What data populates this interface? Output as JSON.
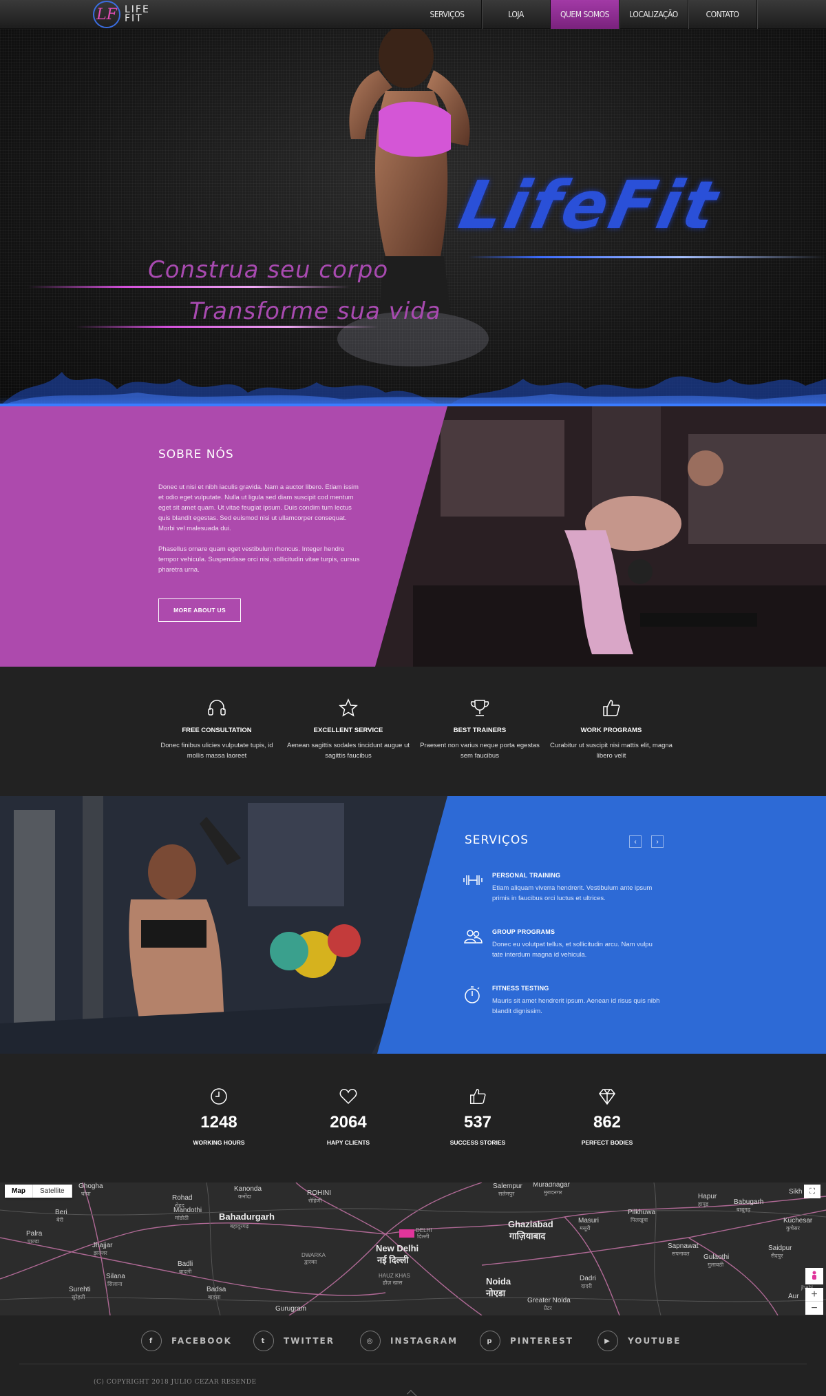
{
  "nav": {
    "logo_line1": "LIFE",
    "logo_line2": "FIT",
    "logo_mark": "LF",
    "items": [
      {
        "label": "SERVIÇOS",
        "active": false
      },
      {
        "label": "LOJA",
        "active": false
      },
      {
        "label": "QUEM SOMOS",
        "active": true
      },
      {
        "label": "LOCALIZAÇÃO",
        "active": false
      },
      {
        "label": "CONTATO",
        "active": false
      }
    ]
  },
  "hero": {
    "brand": "LifeFit",
    "slogan1": "Construa seu corpo",
    "slogan2": "Transforme sua vida"
  },
  "about": {
    "title": "SOBRE NÓS",
    "p1": "Donec ut nisi et nibh iaculis gravida. Nam a auctor libero. Etiam issim et odio eget vulputate. Nulla ut ligula sed diam suscipit cod mentum eget sit amet quam. Ut vitae feugiat ipsum. Duis condim tum lectus quis blandit egestas. Sed euismod nisi ut ullamcorper consequat. Morbi vel malesuada dui.",
    "p2": "Phasellus ornare quam eget vestibulum rhoncus. Integer hendre tempor vehicula. Suspendisse orci nisi, sollicitudin vitae turpis, cursus pharetra urna.",
    "button": "MORE ABOUT US"
  },
  "features": [
    {
      "icon": "headset-icon",
      "title": "FREE CONSULTATION",
      "desc": "Donec finibus ulicies vulputate tupis, id mollis massa laoreet"
    },
    {
      "icon": "star-icon",
      "title": "EXCELLENT SERVICE",
      "desc": "Aenean sagittis sodales tincidunt augue ut sagittis faucibus"
    },
    {
      "icon": "trophy-icon",
      "title": "BEST TRAINERS",
      "desc": "Praesent non varius neque porta egestas sem faucibus"
    },
    {
      "icon": "thumbs-up-icon",
      "title": "WORK PROGRAMS",
      "desc": "Curabitur ut suscipit nisi mattis elit, magna libero velit"
    }
  ],
  "services": {
    "title": "SERVIÇOS",
    "prev": "‹",
    "next": "›",
    "items": [
      {
        "icon": "dumbbell-icon",
        "title": "PERSONAL TRAINING",
        "desc": "Etiam aliquam viverra hendrerit. Vestibulum ante ipsum primis in faucibus orci luctus et ultrices."
      },
      {
        "icon": "group-icon",
        "title": "GROUP PROGRAMS",
        "desc": "Donec eu volutpat tellus, et sollicitudin arcu. Nam vulpu tate interdum magna id vehicula."
      },
      {
        "icon": "stopwatch-icon",
        "title": "FITNESS TESTING",
        "desc": "Mauris sit amet hendrerit ipsum. Aenean id risus quis nibh blandit dignissim."
      }
    ]
  },
  "stats": [
    {
      "icon": "clock-icon",
      "value": "1248",
      "label": "WORKING HOURS"
    },
    {
      "icon": "heart-icon",
      "value": "2064",
      "label": "HAPY CLIENTS"
    },
    {
      "icon": "thumbs-up-icon",
      "value": "537",
      "label": "SUCCESS STORIES"
    },
    {
      "icon": "diamond-icon",
      "value": "862",
      "label": "PERFECT BODIES"
    }
  ],
  "map": {
    "btn_map": "Map",
    "btn_satellite": "Satellite",
    "zoom_in": "+",
    "zoom_out": "−",
    "labels": {
      "ghogha": "Ghogha",
      "ghogha_hi": "घोघा",
      "kanonda": "Kanonda",
      "kanonda_hi": "कनोंदा",
      "rohini": "ROHINI",
      "rohini_hi": "रोहिणी",
      "salempur": "Salempur",
      "salempur_hi": "सलेमपुर",
      "muradnagar": "Muradnagar",
      "muradnagar_hi": "मुरादनगर",
      "hapur": "Hapur",
      "hapur_hi": "हापुड़",
      "babugarh": "Babugarh",
      "babugarh_hi": "बाबूगढ़",
      "sikh": "Sikh",
      "beri": "Beri",
      "beri_hi": "बेरी",
      "rohad": "Rohad",
      "rohad_hi": "रोहद",
      "mandothi": "Mandothi",
      "mandothi_hi": "मांडोठी",
      "bahadurgarh": "Bahadurgarh",
      "bahadurgarh_hi": "बहादुरगढ़",
      "ghaziabad": "Ghaziabad",
      "ghaziabad_hi": "गाज़ियाबाद",
      "masuri": "Masuri",
      "masuri_hi": "मसूरी",
      "pilkhuwa": "Pilkhuwa",
      "pilkhuwa_hi": "पिलखुवा",
      "kuchesar": "Kuchesar",
      "kuchesar_hi": "कुचेसर",
      "palra": "Palra",
      "palra_hi": "पाल्डा",
      "jhajjar": "Jhajjar",
      "jhajjar_hi": "झज्जर",
      "delhi": "DELHI",
      "delhi_hi": "दिल्ली",
      "new_delhi": "New Delhi",
      "new_delhi_hi": "नई दिल्ली",
      "dwarka": "DWARKA",
      "dwarka_hi": "द्वारका",
      "sapnawat": "Sapnawat",
      "sapnawat_hi": "सपनावत",
      "gulaothi": "Gulaothi",
      "gulaothi_hi": "गुलावठी",
      "saidpur": "Saidpur",
      "saidpur_hi": "सैदपुर",
      "badli": "Badli",
      "badli_hi": "बादली",
      "hauz_khas": "HAUZ KHAS",
      "hauz_khas_hi": "हौज़ खास",
      "silana": "Silana",
      "silana_hi": "सिलाना",
      "noida": "Noida",
      "noida_hi": "नोएडा",
      "dadri": "Dadri",
      "dadri_hi": "दादरी",
      "jhahi": "jhahi",
      "surehti": "Surehti",
      "surehti_hi": "सुरेहती",
      "badsa": "Badsa",
      "badsa_hi": "बादसा",
      "greater_noida": "Greater Noida",
      "greater_noida_hi": "ग्रेटर",
      "gurugram": "Gurugram",
      "aur": "Aur"
    }
  },
  "footer": {
    "social": [
      {
        "icon": "facebook-icon",
        "glyph": "f",
        "label": "FACEBOOK"
      },
      {
        "icon": "twitter-icon",
        "glyph": "t",
        "label": "TWITTER"
      },
      {
        "icon": "instagram-icon",
        "glyph": "◎",
        "label": "INSTAGRAM"
      },
      {
        "icon": "pinterest-icon",
        "glyph": "p",
        "label": "PINTEREST"
      },
      {
        "icon": "youtube-icon",
        "glyph": "▶",
        "label": "YOUTUBE"
      }
    ],
    "copyright": "(C) COPYRIGHT 2018 JULIO CEZAR RESENDE"
  },
  "colors": {
    "accent_purple": "#ad4aad",
    "accent_blue": "#2d6ad6",
    "nav_active": "#a23aa6",
    "dark_bg": "#222222"
  }
}
